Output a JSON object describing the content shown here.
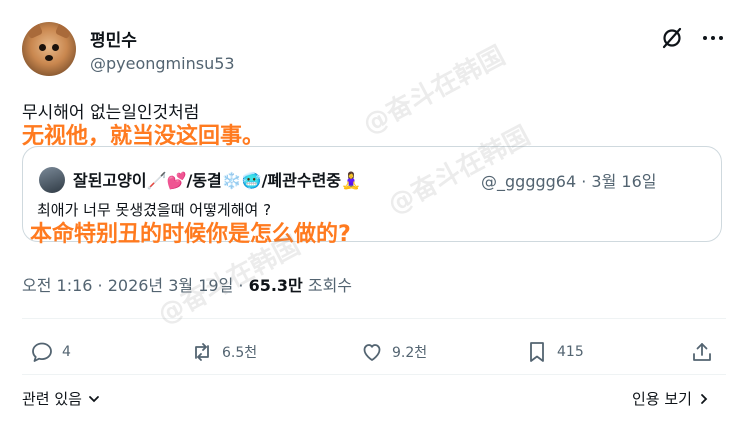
{
  "author": {
    "display_name": "평민수",
    "handle": "@pyeongminsu53"
  },
  "tweet": {
    "text": "무시해어 없는일인것처럼"
  },
  "overlays": {
    "line1": "无视他，就当没这回事。",
    "line2": "本命特别丑的时候你是怎么做的?"
  },
  "quote": {
    "name": "잘된고양이🦯💕/동결❄️🥶/폐관수련중🧘‍♀️",
    "handle_date": "@_ggggg64 · 3월 16일",
    "text": "최애가 너무 못생겼을때 어떻게해여 ?"
  },
  "meta": {
    "time_date": "오전 1:16 · 2026년 3월 19일 · ",
    "views": "65.3만",
    "views_label": " 조회수"
  },
  "actions": {
    "replies": "4",
    "retweets": "6.5천",
    "likes": "9.2천",
    "bookmarks": "415"
  },
  "footer": {
    "related": "관련 있음",
    "quote_tweets": "인용 보기"
  },
  "watermark": {
    "text": "@奋斗在韩国"
  },
  "icons": {
    "grok": "grok-icon",
    "more": "more-icon",
    "reply": "reply-icon",
    "retweet": "retweet-icon",
    "like": "heart-icon",
    "bookmark": "bookmark-icon",
    "share": "share-icon"
  },
  "colors": {
    "overlay": "#ff7a1f",
    "secondary": "#536471",
    "border": "#cfd9de"
  }
}
